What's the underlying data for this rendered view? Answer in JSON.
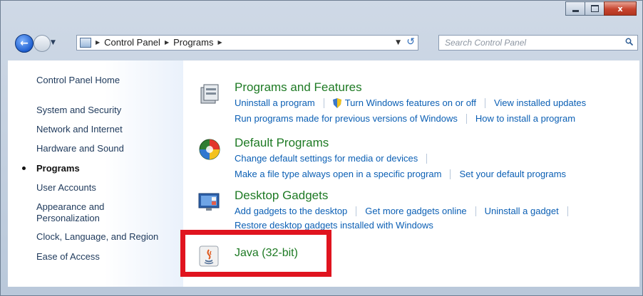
{
  "window": {
    "caption_buttons": [
      "minimize",
      "maximize",
      "close"
    ],
    "close_glyph": "x"
  },
  "navbar": {
    "breadcrumbs": [
      "Control Panel",
      "Programs"
    ],
    "search_placeholder": "Search Control Panel"
  },
  "sidebar": {
    "items": [
      {
        "label": "Control Panel Home",
        "active": false
      },
      {
        "label": "System and Security",
        "active": false
      },
      {
        "label": "Network and Internet",
        "active": false
      },
      {
        "label": "Hardware and Sound",
        "active": false
      },
      {
        "label": "Programs",
        "active": true
      },
      {
        "label": "User Accounts",
        "active": false
      },
      {
        "label": "Appearance and\nPersonalization",
        "active": false
      },
      {
        "label": "Clock, Language, and Region",
        "active": false
      },
      {
        "label": "Ease of Access",
        "active": false
      }
    ]
  },
  "main": {
    "sections": [
      {
        "title": "Programs and Features",
        "icon": "programs-features-icon",
        "rows": [
          [
            "Uninstall a program",
            "Turn Windows features on or off",
            "View installed updates"
          ],
          [
            "Run programs made for previous versions of Windows",
            "How to install a program"
          ]
        ]
      },
      {
        "title": "Default Programs",
        "icon": "default-programs-icon",
        "rows": [
          [
            "Change default settings for media or devices"
          ],
          [
            "Make a file type always open in a specific program",
            "Set your default programs"
          ]
        ]
      },
      {
        "title": "Desktop Gadgets",
        "icon": "desktop-gadgets-icon",
        "rows": [
          [
            "Add gadgets to the desktop",
            "Get more gadgets online",
            "Uninstall a gadget"
          ],
          [
            "Restore desktop gadgets installed with Windows"
          ]
        ]
      },
      {
        "title": "Java (32-bit)",
        "icon": "java-icon",
        "rows": []
      }
    ]
  },
  "colors": {
    "link": "#0b5fb4",
    "section_title": "#1e7a24",
    "highlight": "#e0141f"
  }
}
